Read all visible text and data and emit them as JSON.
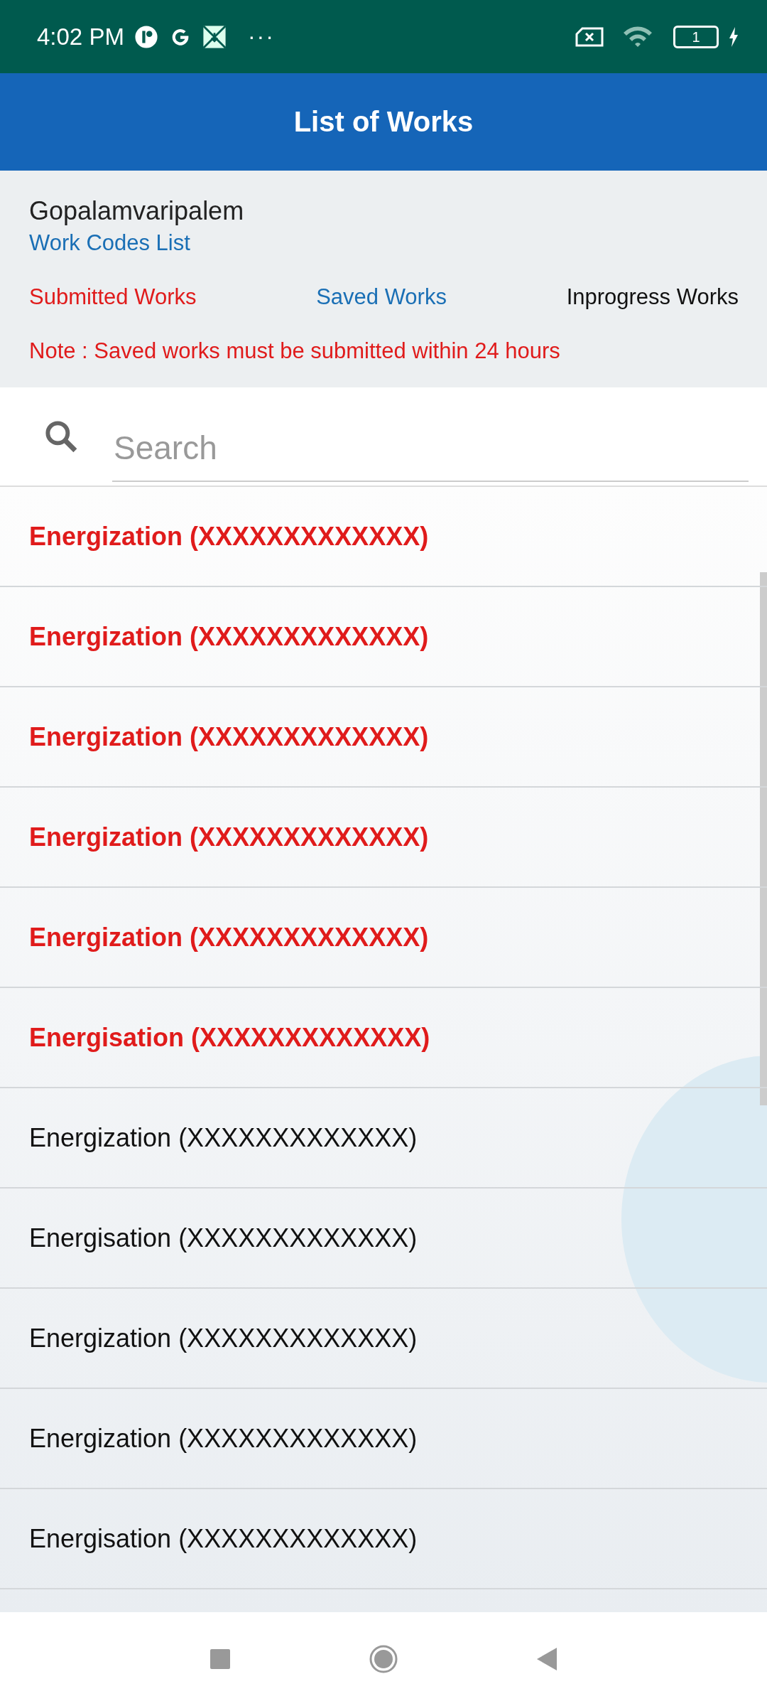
{
  "status_bar": {
    "time": "4:02 PM",
    "more": "···",
    "battery": "1"
  },
  "app_bar": {
    "title": "List of Works"
  },
  "header": {
    "village": "Gopalamvaripalem",
    "link": "Work Codes List"
  },
  "filters": [
    {
      "label": "Submitted Works",
      "kind": "submitted"
    },
    {
      "label": "Saved Works",
      "kind": "saved"
    },
    {
      "label": "Inprogress Works",
      "kind": "inprogress"
    }
  ],
  "note": "Note :  Saved works must be submitted within 24 hours",
  "search": {
    "placeholder": "Search"
  },
  "works": [
    {
      "label": "Energization (XXXXXXXXXXXXX)",
      "kind": "submitted"
    },
    {
      "label": "Energization (XXXXXXXXXXXXX)",
      "kind": "submitted"
    },
    {
      "label": "Energization (XXXXXXXXXXXXX)",
      "kind": "submitted"
    },
    {
      "label": "Energization (XXXXXXXXXXXXX)",
      "kind": "submitted"
    },
    {
      "label": "Energization (XXXXXXXXXXXXX)",
      "kind": "submitted"
    },
    {
      "label": "Energisation (XXXXXXXXXXXXX)",
      "kind": "submitted"
    },
    {
      "label": "Energization (XXXXXXXXXXXXX)",
      "kind": "inprogress"
    },
    {
      "label": "Energisation (XXXXXXXXXXXXX)",
      "kind": "inprogress"
    },
    {
      "label": "Energization (XXXXXXXXXXXXX)",
      "kind": "inprogress"
    },
    {
      "label": "Energization (XXXXXXXXXXXXX)",
      "kind": "inprogress"
    },
    {
      "label": "Energisation (XXXXXXXXXXXXX)",
      "kind": "inprogress"
    }
  ]
}
